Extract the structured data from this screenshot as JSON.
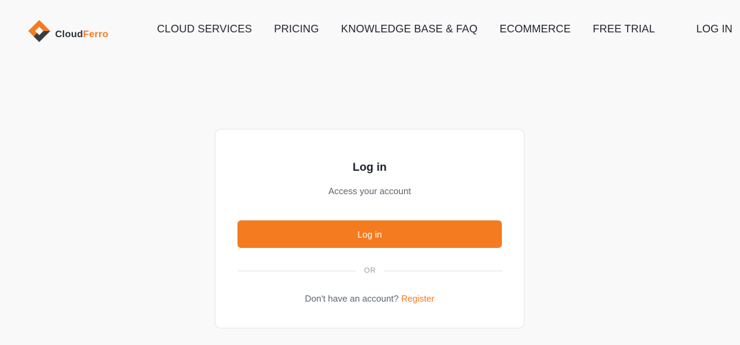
{
  "header": {
    "logo": {
      "text_part1": "Cloud",
      "text_part2": "Ferro",
      "icon": "cloudferro-logo-icon"
    },
    "nav_items": [
      {
        "label": "CLOUD SERVICES"
      },
      {
        "label": "PRICING"
      },
      {
        "label": "KNOWLEDGE BASE & FAQ"
      },
      {
        "label": "ECOMMERCE"
      },
      {
        "label": "FREE TRIAL"
      }
    ],
    "login_label": "LOG IN"
  },
  "login_card": {
    "title": "Log in",
    "subtitle": "Access your account",
    "button_label": "Log in",
    "divider_text": "OR",
    "register_prompt": "Don't have an account?",
    "register_link": "Register"
  },
  "colors": {
    "accent": "#f47b20",
    "background": "#f9f9fa",
    "card": "#ffffff",
    "text": "#1f232a"
  }
}
